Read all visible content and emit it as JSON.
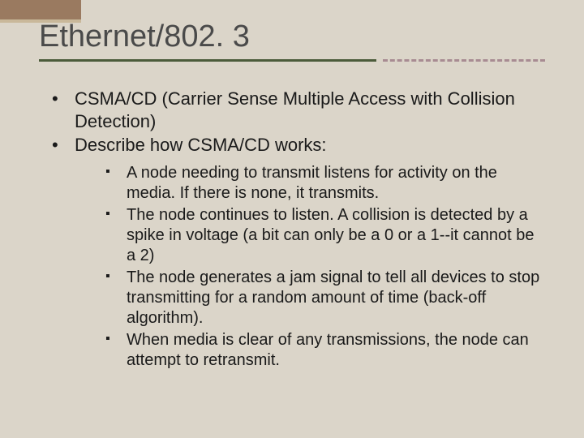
{
  "title": "Ethernet/802. 3",
  "bullets": {
    "l1": [
      "CSMA/CD (Carrier Sense Multiple Access with Collision Detection)",
      "Describe how CSMA/CD works:"
    ],
    "l2": [
      "A node needing to transmit listens for activity on the media.  If there is none, it transmits.",
      "The node continues to listen.  A collision is detected by a spike in voltage (a bit can only be a 0 or a 1--it cannot be a 2)",
      "The node generates a jam signal to tell all devices to stop transmitting for a random amount of time (back-off algorithm).",
      "When media is clear of any transmissions, the node can attempt to retransmit."
    ]
  }
}
